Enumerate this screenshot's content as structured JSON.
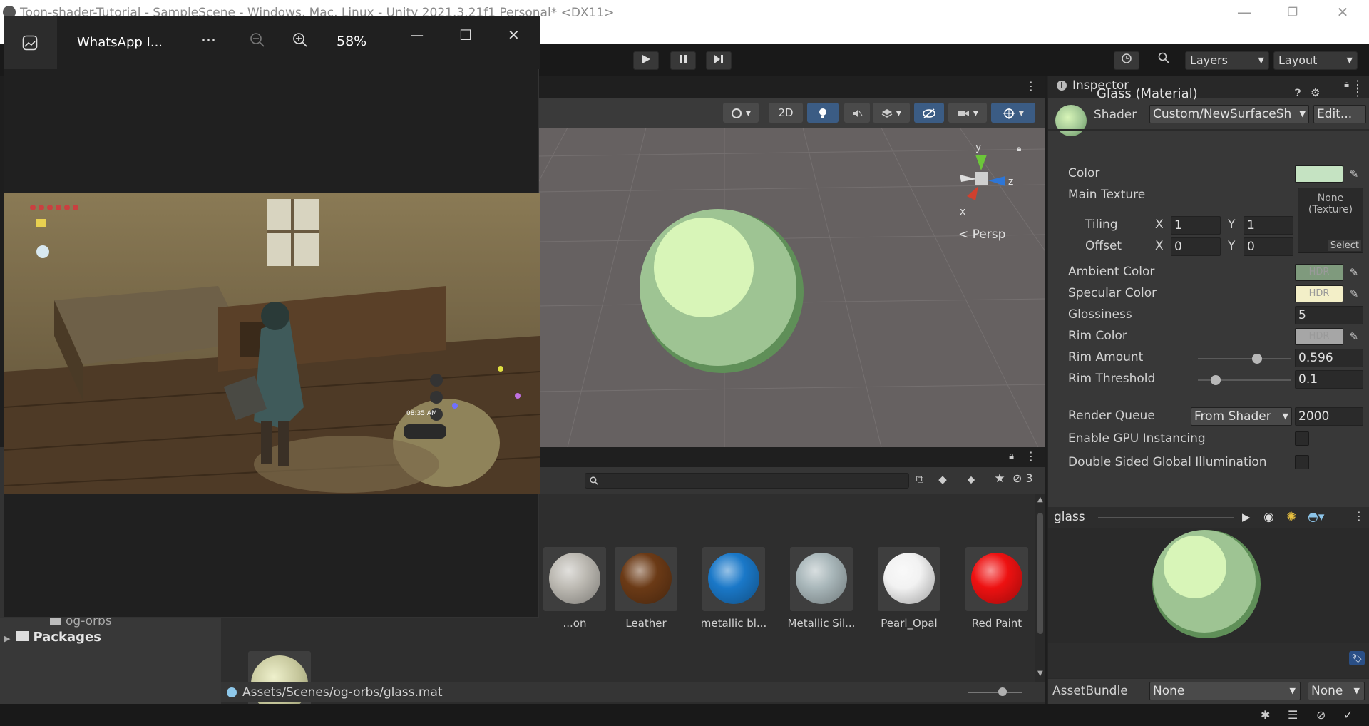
{
  "window": {
    "title": "Toon-shader-Tutorial - SampleScene - Windows, Mac, Linux - Unity 2021.3.21f1 Personal* <DX11>",
    "minimize": "—",
    "restore": "❐",
    "close": "✕"
  },
  "toolbar": {
    "layers_label": "Layers",
    "layout_label": "Layout"
  },
  "viewer": {
    "title": "WhatsApp I...",
    "more": "···",
    "zoom_out": "−",
    "zoom_in": "+",
    "zoom_level": "58%",
    "minimize": "—",
    "maximize": "☐",
    "close": "✕"
  },
  "scene": {
    "toggle_2d": "2D",
    "gizmo_y": "y",
    "gizmo_z": "z",
    "gizmo_x": "x",
    "persp_label": "< Persp"
  },
  "project": {
    "hidden_count": "3",
    "assets": [
      {
        "name": "...on",
        "color": "#bdbab3"
      },
      {
        "name": "Leather",
        "color": "#6b3a16"
      },
      {
        "name": "metallic bl...",
        "color": "#1a78c8"
      },
      {
        "name": "Metallic Sil...",
        "color": "#a9b7ba"
      },
      {
        "name": "Pearl_Opal",
        "color": "#f2f2f2"
      },
      {
        "name": "Red Paint",
        "color": "#ee1111"
      }
    ],
    "second_row_asset_color": "#c6c79c",
    "path": "Assets/Scenes/og-orbs/glass.mat"
  },
  "hierarchy": {
    "items": [
      {
        "label": "og-orbs"
      },
      {
        "label": "Packages"
      }
    ]
  },
  "inspector": {
    "tab_label": "Inspector",
    "material_name": "Glass (Material)",
    "shader_label": "Shader",
    "shader_value": "Custom/NewSurfaceSh",
    "edit_button": "Edit...",
    "color_label": "Color",
    "color_value": "#c5e3c2",
    "main_texture_label": "Main Texture",
    "texture_none": "None",
    "texture_type": "(Texture)",
    "select_button": "Select",
    "tiling_label": "Tiling",
    "tiling_x": "1",
    "tiling_y": "1",
    "offset_label": "Offset",
    "offset_x": "0",
    "offset_y": "0",
    "axis_x": "X",
    "axis_y": "Y",
    "ambient_label": "Ambient Color",
    "ambient_color": "#7f9a7d",
    "specular_label": "Specular Color",
    "specular_color": "#f3efc8",
    "hdr": "HDR",
    "glossiness_label": "Glossiness",
    "glossiness_value": "5",
    "rim_color_label": "Rim Color",
    "rim_color": "#a6a6a6",
    "rim_amount_label": "Rim Amount",
    "rim_amount_value": "0.596",
    "rim_threshold_label": "Rim Threshold",
    "rim_threshold_value": "0.1",
    "render_queue_label": "Render Queue",
    "render_queue_mode": "From Shader",
    "render_queue_value": "2000",
    "gpu_instancing_label": "Enable GPU Instancing",
    "double_sided_label": "Double Sided Global Illumination",
    "preview_name": "glass",
    "assetbundle_label": "AssetBundle",
    "assetbundle_value": "None",
    "assetbundle_variant": "None"
  },
  "game_hud": {
    "time": "08:35 AM"
  }
}
